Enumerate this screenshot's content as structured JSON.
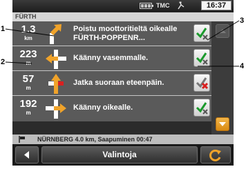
{
  "statusbar": {
    "tmc_label": "TMC",
    "time": "16:37",
    "icons": [
      "battery-icon",
      "gps-satellite-icon"
    ]
  },
  "location": {
    "city": "FÜRTH"
  },
  "route_steps": [
    {
      "distance": "1.3",
      "unit": "km",
      "instruction": "Poistu moottoritieltä oikealle FÜRTH-POPPENR...",
      "maneuver": "exit-right",
      "enabled": true
    },
    {
      "distance": "223",
      "unit": "m",
      "instruction": "Käänny vasemmalle.",
      "maneuver": "turn-left",
      "enabled": true
    },
    {
      "distance": "57",
      "unit": "m",
      "instruction": "Jatka suoraan eteenpäin.",
      "maneuver": "straight",
      "enabled": false
    },
    {
      "distance": "192",
      "unit": "m",
      "instruction": "Käänny oikealle.",
      "maneuver": "turn-right",
      "enabled": true
    }
  ],
  "destination_bar": {
    "text": "NÜRNBERG 4.0 km, Saapuminen 00:47"
  },
  "bottombar": {
    "options_label": "Valintoja"
  },
  "callouts": {
    "c1": "1",
    "c2": "2",
    "c3": "3",
    "c4": "4"
  },
  "colors": {
    "accent": "#f0a32a",
    "dark_row": "#5a5a5a",
    "background": "#2b2b2b",
    "disabled_x": "#d92020"
  }
}
